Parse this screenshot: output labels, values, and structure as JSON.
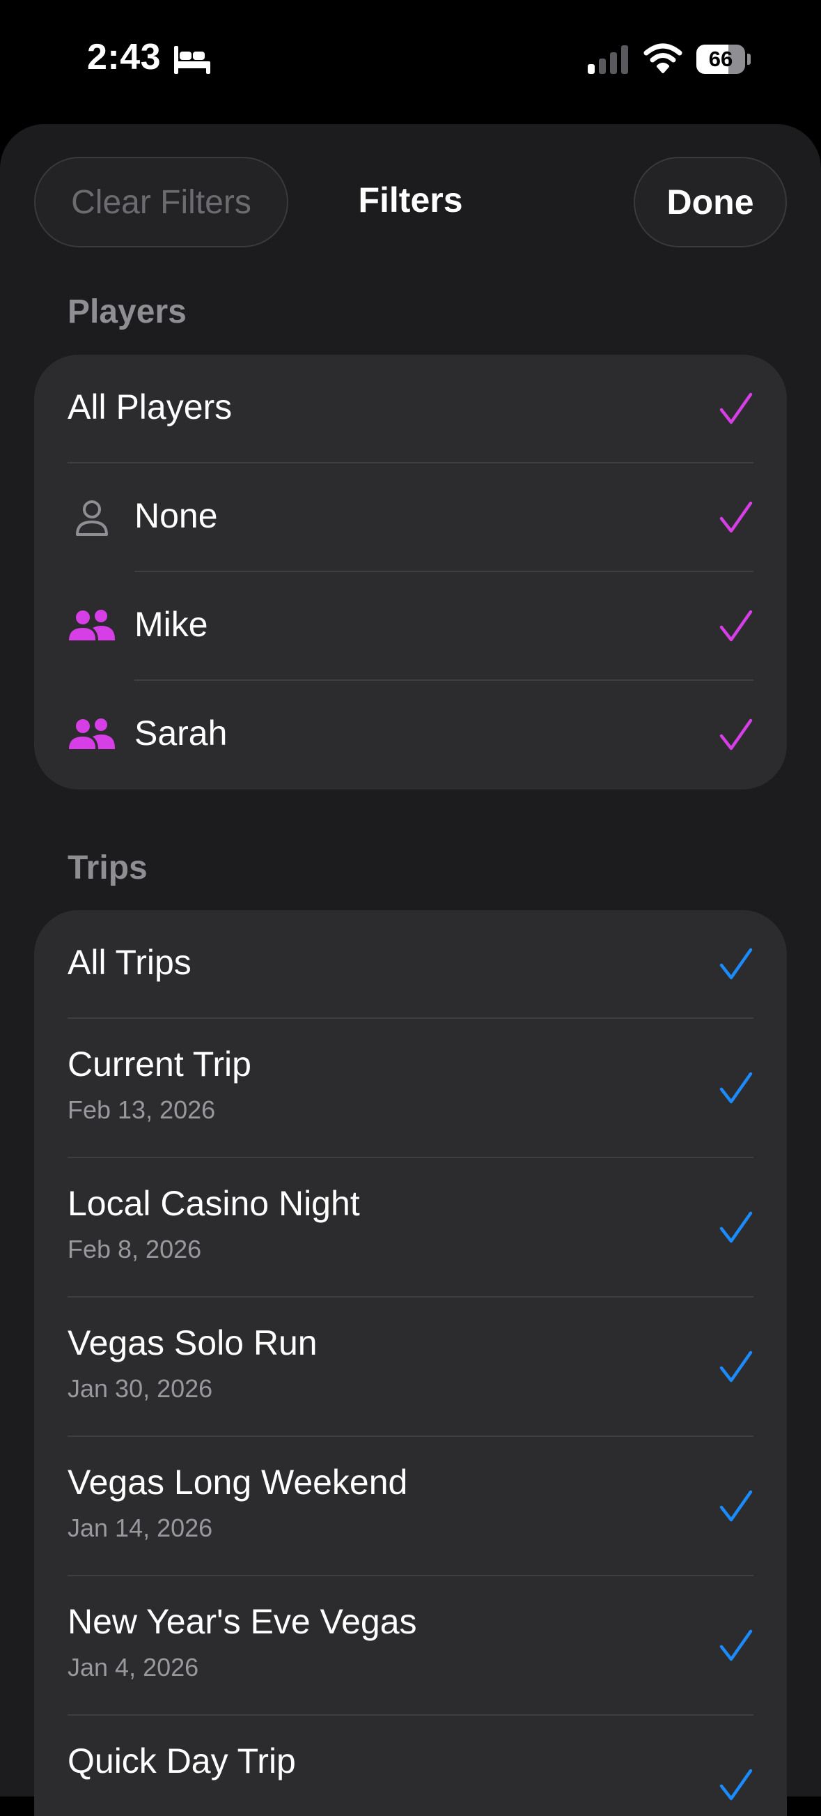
{
  "status_bar": {
    "time": "2:43",
    "battery": "66"
  },
  "header": {
    "clear_label": "Clear Filters",
    "title": "Filters",
    "done_label": "Done"
  },
  "players": {
    "header": "Players",
    "check_color": "#d63ee6",
    "items": [
      {
        "label": "All Players",
        "icon": "none",
        "selected": true
      },
      {
        "label": "None",
        "icon": "person-outline-icon",
        "selected": true
      },
      {
        "label": "Mike",
        "icon": "people-icon",
        "selected": true
      },
      {
        "label": "Sarah",
        "icon": "people-icon",
        "selected": true
      }
    ]
  },
  "trips": {
    "header": "Trips",
    "check_color": "#1a8cff",
    "items": [
      {
        "label": "All Trips",
        "date": "",
        "selected": true
      },
      {
        "label": "Current Trip",
        "date": "Feb 13, 2026",
        "selected": true
      },
      {
        "label": "Local Casino Night",
        "date": "Feb 8, 2026",
        "selected": true
      },
      {
        "label": "Vegas Solo Run",
        "date": "Jan 30, 2026",
        "selected": true
      },
      {
        "label": "Vegas Long Weekend",
        "date": "Jan 14, 2026",
        "selected": true
      },
      {
        "label": "New Year's Eve Vegas",
        "date": "Jan 4, 2026",
        "selected": true
      },
      {
        "label": "Quick Day Trip",
        "date": "",
        "selected": true
      }
    ]
  }
}
